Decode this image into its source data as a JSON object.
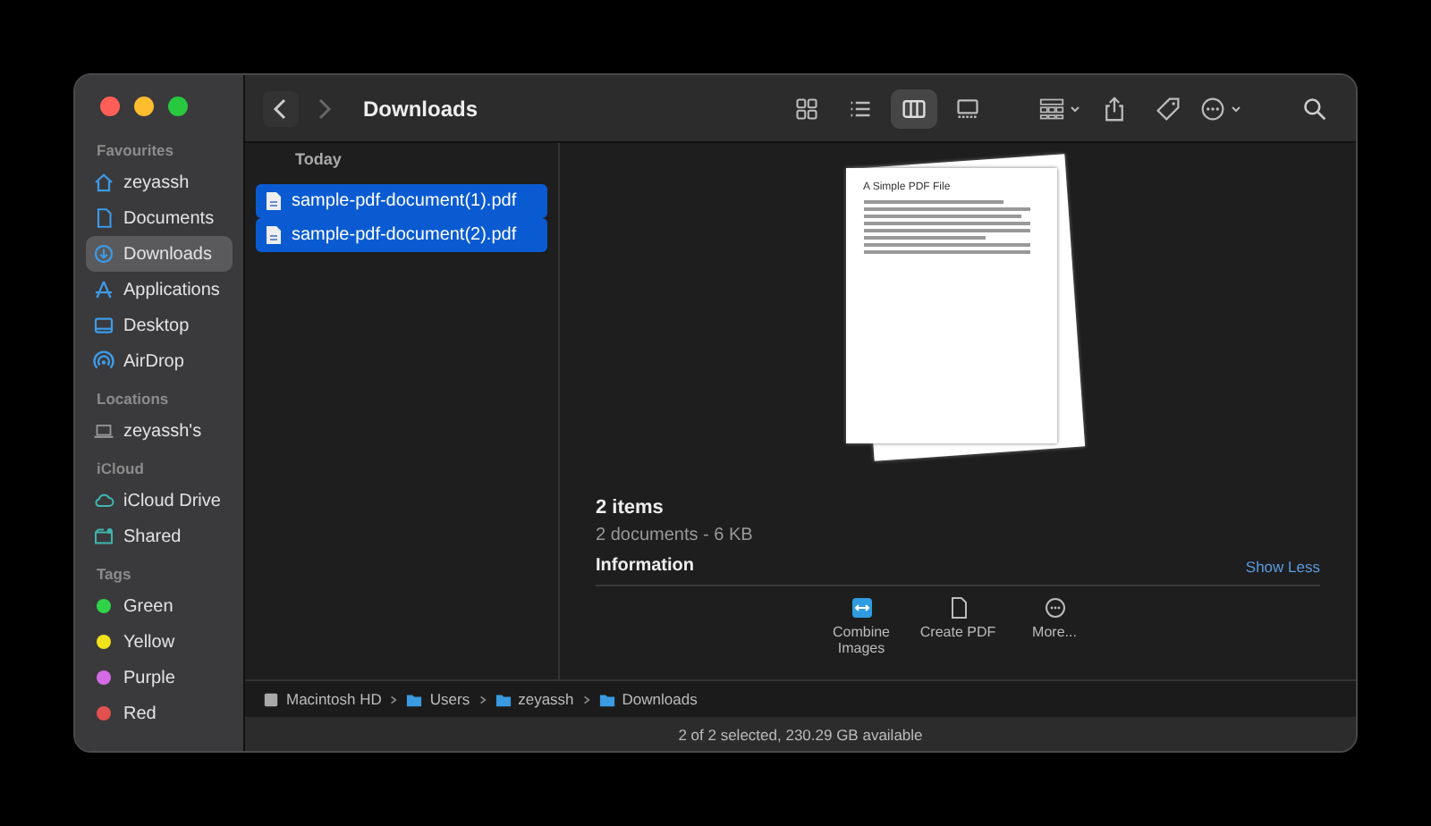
{
  "window": {
    "title": "Downloads"
  },
  "sidebar": {
    "sections": [
      {
        "heading": "Favourites",
        "items": [
          {
            "label": "zeyassh",
            "kind": "place",
            "selected": false
          },
          {
            "label": "Documents",
            "kind": "place",
            "selected": false
          },
          {
            "label": "Downloads",
            "kind": "place",
            "selected": true
          },
          {
            "label": "Applications",
            "kind": "place",
            "selected": false
          },
          {
            "label": "Desktop",
            "kind": "place",
            "selected": false
          },
          {
            "label": "AirDrop",
            "kind": "place",
            "selected": false
          }
        ]
      },
      {
        "heading": "Locations",
        "items": [
          {
            "label": "zeyassh's",
            "kind": "place",
            "selected": false
          }
        ]
      },
      {
        "heading": "iCloud",
        "items": [
          {
            "label": "iCloud Drive",
            "kind": "place",
            "selected": false
          },
          {
            "label": "Shared",
            "kind": "place",
            "selected": false
          }
        ]
      },
      {
        "heading": "Tags",
        "items": [
          {
            "label": "Green",
            "kind": "tag",
            "color": "#2fd34a",
            "selected": false
          },
          {
            "label": "Yellow",
            "kind": "tag",
            "color": "#f2e21b",
            "selected": false
          },
          {
            "label": "Purple",
            "kind": "tag",
            "color": "#d36be6",
            "selected": false
          },
          {
            "label": "Red",
            "kind": "tag",
            "color": "#e2514f",
            "selected": false
          }
        ]
      }
    ]
  },
  "toolbar": {
    "view_modes": [
      {
        "selected": false
      },
      {
        "selected": false
      },
      {
        "selected": true
      },
      {
        "selected": false
      }
    ]
  },
  "column": {
    "heading": "Today",
    "files": [
      {
        "name": "sample-pdf-document(1).pdf",
        "selected": true
      },
      {
        "name": "sample-pdf-document(2).pdf",
        "selected": true
      }
    ]
  },
  "preview": {
    "document_title": "A Simple PDF File",
    "summary": "2 items",
    "details": "2 documents - 6 KB",
    "info_heading": "Information",
    "toggle_link": "Show Less",
    "actions": [
      {
        "label": "Combine Images"
      },
      {
        "label": "Create PDF"
      },
      {
        "label": "More..."
      }
    ]
  },
  "path_bar": [
    "Macintosh HD",
    "Users",
    "zeyassh",
    "Downloads"
  ],
  "status_bar": "2 of 2 selected, 230.29 GB available"
}
